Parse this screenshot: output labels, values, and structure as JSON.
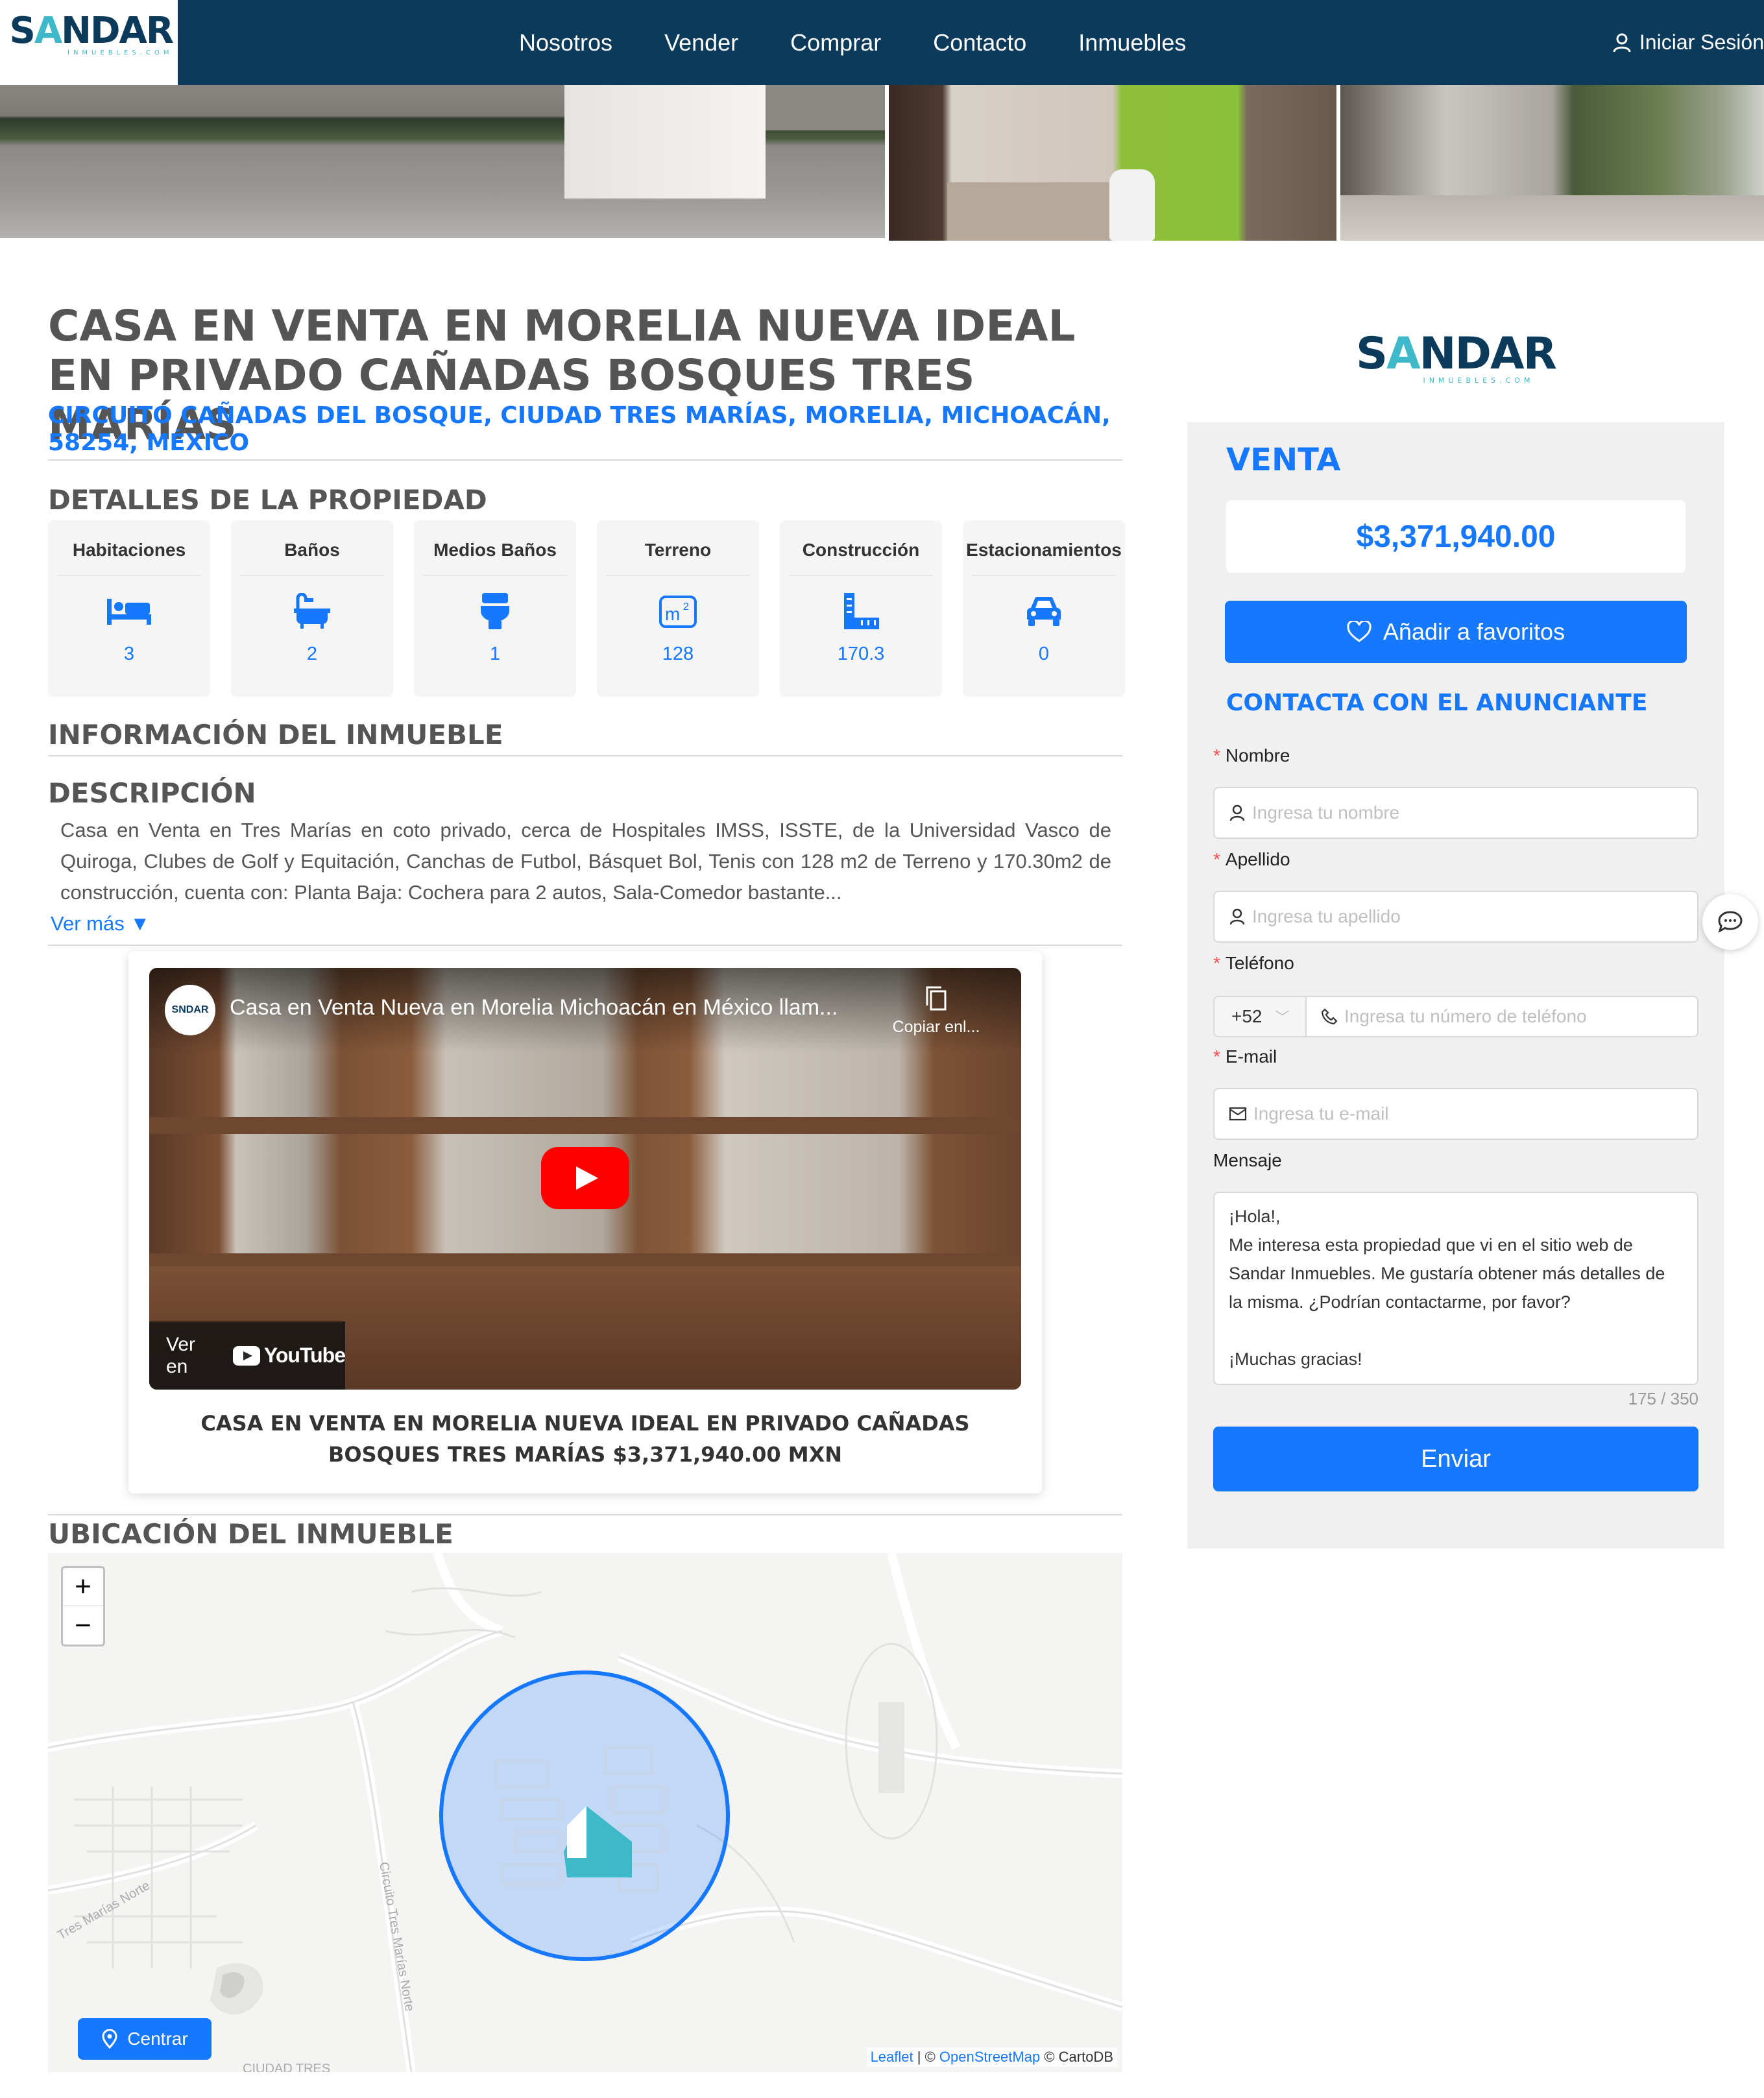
{
  "brand": {
    "name_s": "S",
    "name_a": "A",
    "name_ndar": "NDAR",
    "name_r": "R",
    "sub": "INMUEBLES.COM"
  },
  "nav": {
    "links": [
      "Nosotros",
      "Vender",
      "Comprar",
      "Contacto",
      "Inmuebles"
    ],
    "login": "Iniciar Sesión"
  },
  "property": {
    "title": "CASA EN VENTA EN MORELIA NUEVA IDEAL EN PRIVADO CAÑADAS BOSQUES TRES MARÍAS",
    "address": "CIRCUITO CAÑADAS DEL BOSQUE, CIUDAD TRES MARÍAS, MORELIA, MICHOACÁN, 58254, MÉXICO"
  },
  "details": {
    "section_title": "DETALLES DE LA PROPIEDAD",
    "features": [
      {
        "label": "Habitaciones",
        "value": "3",
        "icon": "bed-icon"
      },
      {
        "label": "Baños",
        "value": "2",
        "icon": "bathtub-icon"
      },
      {
        "label": "Medios Baños",
        "value": "1",
        "icon": "toilet-icon"
      },
      {
        "label": "Terreno",
        "value": "128",
        "icon": "square-meters-icon"
      },
      {
        "label": "Construcción",
        "value": "170.3",
        "icon": "ruler-icon"
      },
      {
        "label": "Estacionamientos",
        "value": "0",
        "icon": "car-icon"
      }
    ]
  },
  "info": {
    "section_title": "INFORMACIÓN DEL INMUEBLE",
    "desc_title": "DESCRIPCIÓN",
    "description": "Casa en Venta en Tres Marías en coto privado, cerca de Hospitales IMSS, ISSTE, de la Universidad Vasco de Quiroga, Clubes de Golf y Equitación, Canchas de Futbol, Básquet Bol, Tenis con 128 m2 de Terreno y 170.30m2 de construcción, cuenta con: Planta Baja: Cochera para 2 autos, Sala-Comedor bastante...",
    "ver_mas": "Ver más ▼"
  },
  "video": {
    "channel_logo": "SNDAR",
    "title": "Casa en Venta Nueva en Morelia Michoacán en México llam...",
    "copy": "Copiar enl...",
    "ver_en": "Ver en",
    "youtube": "YouTube",
    "caption": "CASA EN VENTA EN MORELIA NUEVA IDEAL EN PRIVADO CAÑADAS BOSQUES TRES MARÍAS $3,371,940.00 MXN"
  },
  "location": {
    "section_title": "UBICACIÓN DEL INMUEBLE",
    "zoom_in": "+",
    "zoom_out": "−",
    "center_button": "Centrar",
    "attribution_leaflet": "Leaflet",
    "attribution_sep": " | © ",
    "attribution_osm": "OpenStreetMap",
    "attribution_carto": " © CartoDB",
    "road_labels": [
      "Tres Marías Norte",
      "Circuito Tres Marías Norte",
      "CIUDAD TRES"
    ]
  },
  "sidebar": {
    "operation": "VENTA",
    "price": "$3,371,940.00",
    "favorite_button": "Añadir a favoritos",
    "contact_title": "CONTACTA CON EL ANUNCIANTE",
    "form": {
      "name_label": "Nombre",
      "name_placeholder": "Ingresa tu nombre",
      "lastname_label": "Apellido",
      "lastname_placeholder": "Ingresa tu apellido",
      "phone_label": "Teléfono",
      "phone_prefix": "+52",
      "phone_placeholder": "Ingresa tu número de teléfono",
      "email_label": "E-mail",
      "email_placeholder": "Ingresa tu e-mail",
      "message_label": "Mensaje",
      "message_value": "¡Hola!,\nMe interesa esta propiedad que vi en el sitio web de Sandar Inmuebles. Me gustaría obtener más detalles de la misma. ¿Podrían contactarme, por favor?\n\n¡Muchas gracias!",
      "counter": "175 / 350",
      "submit": "Enviar"
    }
  },
  "colors": {
    "navy": "#0b3a5a",
    "teal": "#3fb8c9",
    "primary": "#1677ff",
    "required": "#ff4d4f"
  }
}
